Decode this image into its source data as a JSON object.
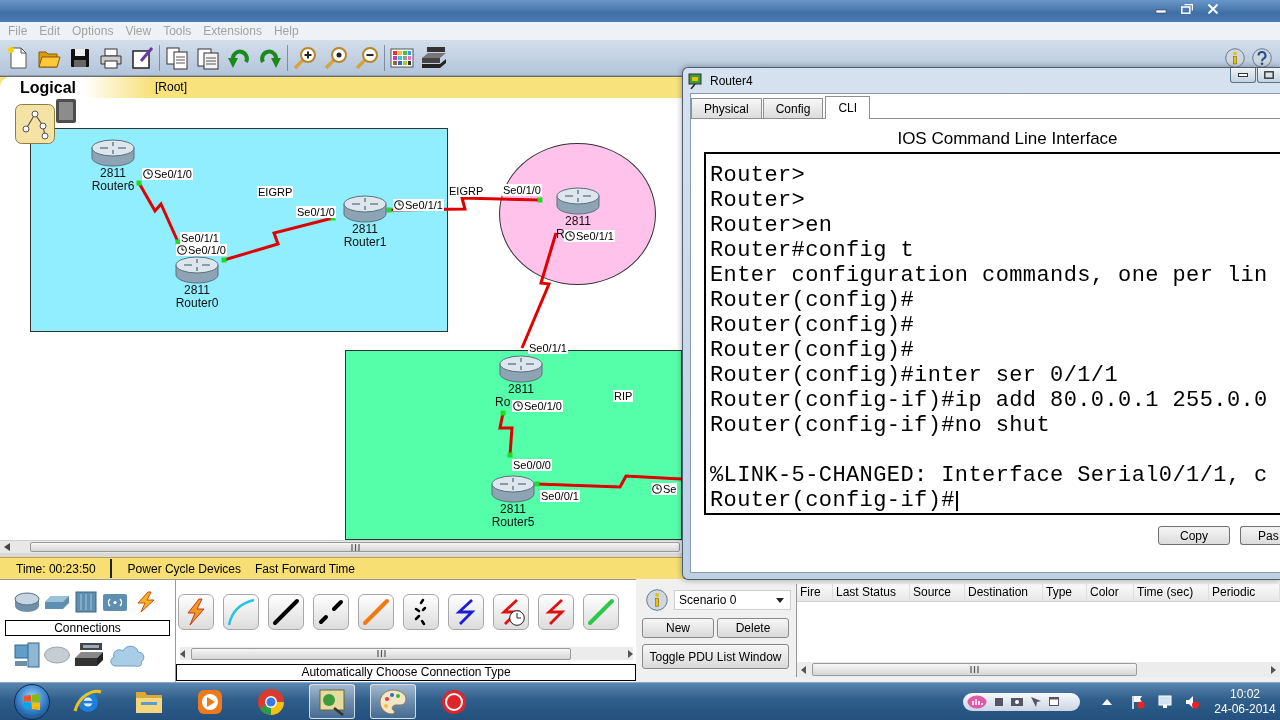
{
  "menu_bar": {
    "items": [
      "File",
      "Edit",
      "Options",
      "View",
      "Tools",
      "Extensions",
      "Help"
    ]
  },
  "workspace": {
    "view": "Logical",
    "path": "[Root]"
  },
  "canvas": {
    "areas": [
      {
        "kind": "rectangle",
        "color": "#90eeff"
      },
      {
        "kind": "ellipse",
        "color": "#ffc2ea"
      },
      {
        "kind": "rectangle",
        "color": "#55ffaa"
      }
    ],
    "area_labels": [
      "EIGRP",
      "EIGRP",
      "RIP"
    ],
    "routers": [
      {
        "model": "2811",
        "name": "Router6"
      },
      {
        "model": "2811",
        "name": "Router0"
      },
      {
        "model": "2811",
        "name": "Router1"
      },
      {
        "model": "2811",
        "name": "R"
      },
      {
        "model": "2811",
        "name": "Ro"
      },
      {
        "model": "2811",
        "name": "Router5"
      }
    ],
    "port_labels": [
      {
        "text": "Se0/1/0",
        "clock": true
      },
      {
        "text": "Se0/1/1",
        "clock": false
      },
      {
        "text": "Se0/1/0",
        "clock": true
      },
      {
        "text": "Se0/1/0",
        "clock": false
      },
      {
        "text": "Se0/1/1",
        "clock": true
      },
      {
        "text": "Se0/1/0",
        "clock": false
      },
      {
        "text": "Se0/1/1",
        "clock": true
      },
      {
        "text": "Se0/1/1",
        "clock": false
      },
      {
        "text": "Se0/1/0",
        "clock": true
      },
      {
        "text": "Se0/0/0",
        "clock": false
      },
      {
        "text": "Se0/0/1",
        "clock": false
      },
      {
        "text": "Se",
        "clock": true
      }
    ]
  },
  "device_window": {
    "title": "Router4",
    "tabs": [
      {
        "label": "Physical",
        "selected": false
      },
      {
        "label": "Config",
        "selected": false
      },
      {
        "label": "CLI",
        "selected": true
      }
    ],
    "heading": "IOS Command Line Interface",
    "lines": [
      {
        "kind": "line",
        "text": "Router>"
      },
      {
        "kind": "line",
        "text": "Router>"
      },
      {
        "kind": "line",
        "text": "Router>en"
      },
      {
        "kind": "line",
        "text": "Router#config t"
      },
      {
        "kind": "line",
        "text": "Enter configuration commands, one per lin"
      },
      {
        "kind": "line",
        "text": "Router(config)#"
      },
      {
        "kind": "line",
        "text": "Router(config)#"
      },
      {
        "kind": "line",
        "text": "Router(config)#"
      },
      {
        "kind": "line",
        "text": "Router(config)#inter ser 0/1/1"
      },
      {
        "kind": "line",
        "text": "Router(config-if)#ip add 80.0.0.1 255.0.0"
      },
      {
        "kind": "line",
        "text": "Router(config-if)#no shut"
      },
      {
        "kind": "message",
        "text": "%LINK-5-CHANGED: Interface Serial0/1/1, c"
      },
      {
        "kind": "line",
        "text": "Router(config-if)#"
      }
    ],
    "buttons": [
      "Copy",
      "Pas"
    ]
  },
  "status_bar": {
    "time": "Time: 00:23:50",
    "buttons": [
      "Power Cycle Devices",
      "Fast Forward Time"
    ]
  },
  "device_panel": {
    "category": "Connections"
  },
  "connection_panel": {
    "hint": "Automatically Choose Connection Type"
  },
  "scenario_panel": {
    "scenario": "Scenario 0",
    "buttons": [
      "New",
      "Delete"
    ],
    "toggle": "Toggle PDU List Window"
  },
  "pdu_table": {
    "columns": [
      "Fire",
      "Last Status",
      "Source",
      "Destination",
      "Type",
      "Color",
      "Time (sec)",
      "Periodic"
    ]
  },
  "taskbar": {
    "apps": [
      {
        "kind": "browser",
        "active": false
      },
      {
        "kind": "folder",
        "active": false
      },
      {
        "kind": "media",
        "active": false
      },
      {
        "kind": "wheel",
        "active": false
      },
      {
        "kind": "network",
        "active": true
      },
      {
        "kind": "paint",
        "active": true
      },
      {
        "kind": "record",
        "active": false
      }
    ],
    "time": "10:02",
    "date": "24-06-2014"
  }
}
